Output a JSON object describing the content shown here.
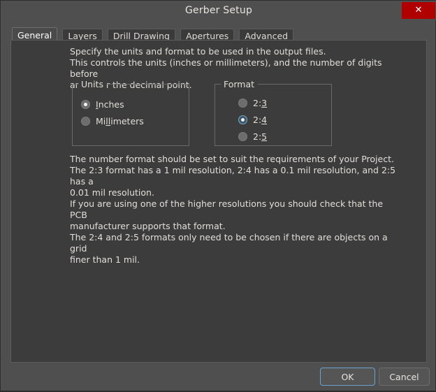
{
  "window": {
    "title": "Gerber Setup",
    "close_icon": "close-x-icon",
    "close_glyph": "✕",
    "close_color": "#b00000"
  },
  "tabs": [
    {
      "label": "General",
      "selected": true
    },
    {
      "label": "Layers",
      "selected": false
    },
    {
      "label": "Drill Drawing",
      "selected": false
    },
    {
      "label": "Apertures",
      "selected": false
    },
    {
      "label": "Advanced",
      "selected": false
    }
  ],
  "general": {
    "intro_text": "Specify the units and format to be used in the output files.\nThis controls the units (inches or millimeters), and the number of digits before\nand after the decimal point.",
    "detail_text": "The number format should be set to suit the requirements of your Project.\nThe 2:3 format has a 1 mil resolution, 2:4 has a 0.1 mil resolution, and 2:5 has a\n0.01 mil resolution.\nIf you are using one of the higher resolutions you should check that the PCB\nmanufacturer supports that format.\nThe 2:4 and 2:5 formats only need to be chosen if there are objects on a grid\nfiner than 1 mil.",
    "units": {
      "title": "Units",
      "options": [
        {
          "label": "Inches",
          "mnemonic": "I",
          "checked": true,
          "focused": false
        },
        {
          "label": "Millimeters",
          "mnemonic": "ll",
          "checked": false,
          "focused": false
        }
      ]
    },
    "format": {
      "title": "Format",
      "options": [
        {
          "label": "2:3",
          "mnemonic": "3",
          "checked": false,
          "focused": false
        },
        {
          "label": "2:4",
          "mnemonic": "4",
          "checked": true,
          "focused": true
        },
        {
          "label": "2:5",
          "mnemonic": "5",
          "checked": false,
          "focused": false
        }
      ]
    }
  },
  "footer": {
    "ok_label": "OK",
    "cancel_label": "Cancel",
    "focus_color": "#6ba3cd"
  }
}
